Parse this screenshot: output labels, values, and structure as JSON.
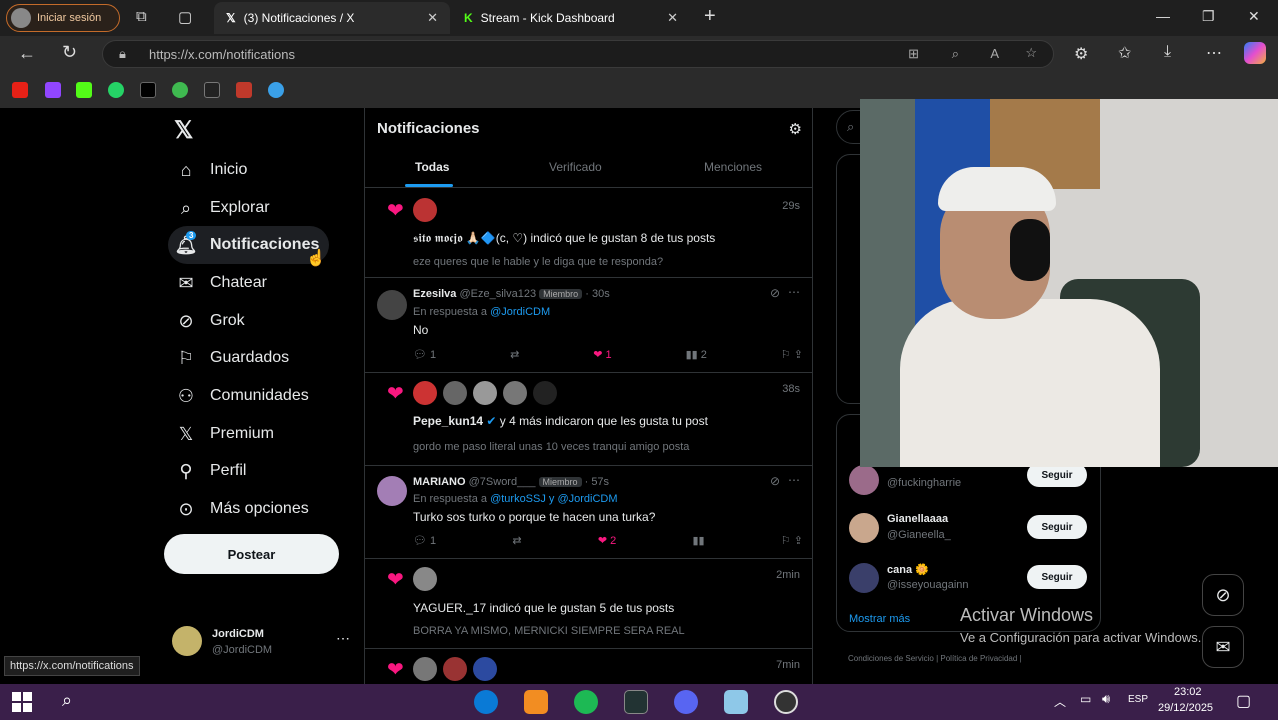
{
  "browser": {
    "profile_label": "Iniciar sesión",
    "tabs": [
      {
        "title": "(3) Notificaciones / X"
      },
      {
        "title": "Stream - Kick Dashboard"
      }
    ],
    "url": "https://x.com/notifications",
    "status_url": "https://x.com/notifications"
  },
  "nav": {
    "items": [
      {
        "label": "Inicio",
        "icon": "home-icon"
      },
      {
        "label": "Explorar",
        "icon": "search-icon"
      },
      {
        "label": "Notificaciones",
        "icon": "bell-icon",
        "badge": "3"
      },
      {
        "label": "Chatear",
        "icon": "mail-icon"
      },
      {
        "label": "Grok",
        "icon": "grok-icon"
      },
      {
        "label": "Guardados",
        "icon": "bookmark-icon"
      },
      {
        "label": "Comunidades",
        "icon": "communities-icon"
      },
      {
        "label": "Premium",
        "icon": "x-logo-icon"
      },
      {
        "label": "Perfil",
        "icon": "person-icon"
      },
      {
        "label": "Más opciones",
        "icon": "more-circle-icon"
      }
    ],
    "post_label": "Postear",
    "account": {
      "name": "JordiCDM",
      "handle": "@JordiCDM"
    }
  },
  "feed": {
    "title": "Notificaciones",
    "tabs": [
      "Todas",
      "Verificado",
      "Menciones"
    ],
    "notifications": [
      {
        "type": "like",
        "text": "𝖘𝖎𝖙𝖔 𝖒𝖔𝖈𝖏𝖔 🙏🏻🔷(c, ♡) indicó que le gustan 8 de tus posts",
        "sub": "eze queres que le hable y le diga que te responda?",
        "time": "29s"
      },
      {
        "type": "reply",
        "name": "Ezesilva",
        "handle": "@Eze_silva123",
        "badge": "Miembro",
        "time": "· 30s",
        "reply_to_prefix": "En respuesta a",
        "reply_to": "@JordiCDM",
        "body": "No",
        "stats": [
          "1",
          "",
          "1",
          "2"
        ]
      },
      {
        "type": "like",
        "text_name": "Pepe_kun14",
        "text_rest": " y 4 más indicaron que les gusta tu post",
        "sub": "gordo me paso literal unas 10 veces tranqui amigo posta",
        "time": "38s"
      },
      {
        "type": "reply",
        "name": "MARIANO",
        "handle": "@7Sword___",
        "badge": "Miembro",
        "time": "· 57s",
        "reply_to_prefix": "En respuesta a",
        "reply_to": "@turkoSSJ y @JordiCDM",
        "body": "Turko sos turko o porque te hacen una turka?",
        "stats": [
          "1",
          "",
          "2",
          ""
        ]
      },
      {
        "type": "like",
        "text": "YAGUER._17 indicó que le gustan 5 de tus posts",
        "sub": "BORRA YA MISMO, MERNICKI SIEMPRE SERA REAL",
        "time": "2min"
      },
      {
        "type": "like",
        "time": "7min"
      }
    ]
  },
  "right": {
    "follow": [
      {
        "name": "",
        "handle": "@fuckingharrie",
        "btn": "Seguir"
      },
      {
        "name": "Gianellaaaa",
        "handle": "@Gianeella_",
        "btn": "Seguir"
      },
      {
        "name": "cana 🌼",
        "handle": "@isseyouagainn",
        "btn": "Seguir"
      }
    ],
    "show_more": "Mostrar más",
    "footer": [
      "Condiciones de Servicio",
      "|",
      "Política de Privacidad",
      "|"
    ]
  },
  "watermark": {
    "title": "Activar Windows",
    "sub": "Ve a Configuración para activar Windows."
  },
  "taskbar": {
    "lang": "ESP",
    "time": "23:02",
    "date": "29/12/2025"
  }
}
